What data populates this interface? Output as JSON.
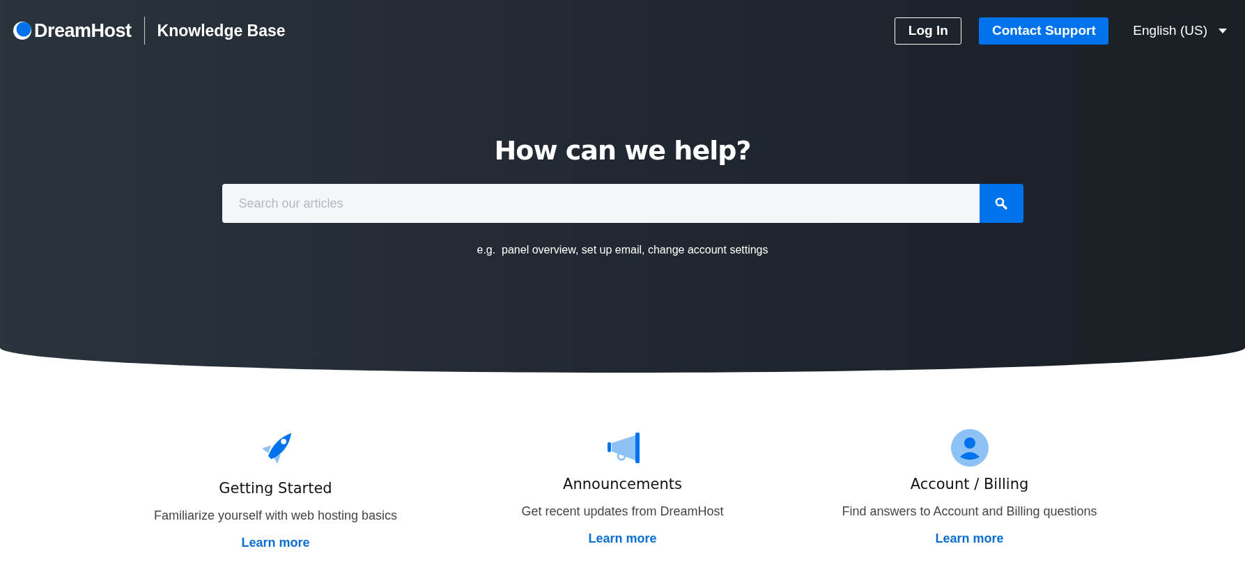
{
  "header": {
    "brand": "DreamHost",
    "section": "Knowledge Base",
    "login": "Log In",
    "contact": "Contact Support",
    "language": "English (US)"
  },
  "hero": {
    "title": "How can we help?",
    "search": {
      "placeholder": "Search our articles"
    },
    "hint": "e.g.  panel overview, set up email, change account settings"
  },
  "categories": [
    {
      "kind": "rocket",
      "title": "Getting Started",
      "description": "Familiarize yourself with web hosting basics",
      "link": "Learn more"
    },
    {
      "kind": "megaphone",
      "title": "Announcements",
      "description": "Get recent updates from DreamHost",
      "link": "Learn more"
    },
    {
      "kind": "user",
      "title": "Account / Billing",
      "description": "Find answers to Account and Billing questions",
      "link": "Learn more"
    }
  ]
}
